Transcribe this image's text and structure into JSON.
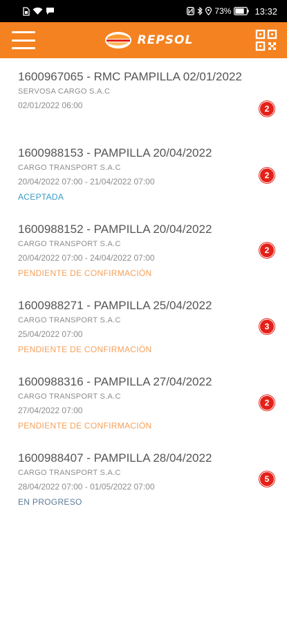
{
  "status_bar": {
    "battery": "73%",
    "time": "13:32"
  },
  "app_bar": {
    "brand": "REPSOL",
    "accent_color": "#f58220"
  },
  "orders": [
    {
      "title": "1600967065 - RMC PAMPILLA 02/01/2022",
      "company": "SERVOSA CARGO S.A.C",
      "dates": "02/01/2022 06:00",
      "status": "",
      "status_color": "",
      "badge": "2"
    },
    {
      "title": "1600988153 - PAMPILLA 20/04/2022",
      "company": "CARGO TRANSPORT S.A.C",
      "dates": "20/04/2022 07:00 - 21/04/2022 07:00",
      "status": "ACEPTADA",
      "status_color": "#3a9bc4",
      "badge": "2"
    },
    {
      "title": "1600988152 - PAMPILLA 20/04/2022",
      "company": "CARGO TRANSPORT S.A.C",
      "dates": "20/04/2022 07:00 - 24/04/2022 07:00",
      "status": "PENDIENTE DE CONFIRMACIÓN",
      "status_color": "#f5a05a",
      "badge": "2"
    },
    {
      "title": "1600988271 - PAMPILLA 25/04/2022",
      "company": "CARGO TRANSPORT S.A.C",
      "dates": "25/04/2022 07:00",
      "status": "PENDIENTE DE CONFIRMACIÓN",
      "status_color": "#f5a05a",
      "badge": "3"
    },
    {
      "title": "1600988316 - PAMPILLA 27/04/2022",
      "company": "CARGO TRANSPORT S.A.C",
      "dates": "27/04/2022 07:00",
      "status": "PENDIENTE DE CONFIRMACIÓN",
      "status_color": "#f5a05a",
      "badge": "2"
    },
    {
      "title": "1600988407 - PAMPILLA 28/04/2022",
      "company": "CARGO TRANSPORT S.A.C",
      "dates": "28/04/2022 07:00 - 01/05/2022 07:00",
      "status": "EN PROGRESO",
      "status_color": "#5b7a96",
      "badge": "5"
    }
  ]
}
